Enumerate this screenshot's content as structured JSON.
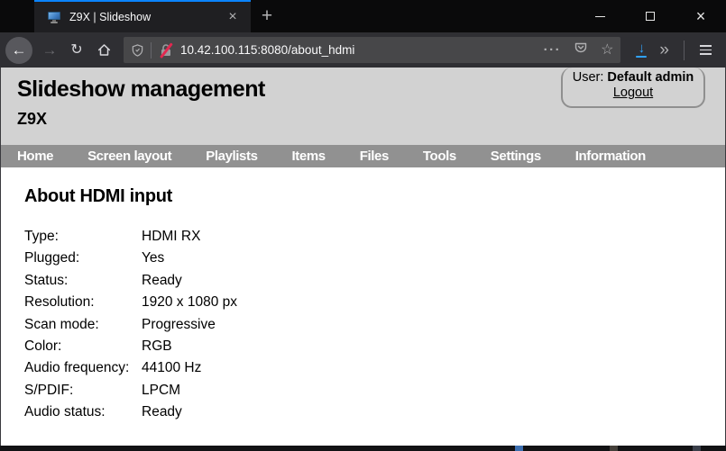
{
  "browser": {
    "tab_bar": {
      "tab_title": "Z9X | Slideshow",
      "favicon": "monitor-icon",
      "tab_close_glyph": "×",
      "new_tab_glyph": "+"
    },
    "window_controls": {
      "close_glyph": "×"
    },
    "toolbar": {
      "back_glyph": "←",
      "forward_glyph": "→",
      "reload_glyph": "↻",
      "url": "10.42.100.115:8080/about_hdmi",
      "page_actions_glyph": "···",
      "bookmark_star_glyph": "☆",
      "download_arrow_glyph": "↓",
      "overflow_glyph": "»",
      "icons": [
        "tracking-shield-icon",
        "insecure-lock-icon",
        "pocket-icon",
        "hamburger-menu-icon",
        "home-icon"
      ]
    }
  },
  "page": {
    "header": {
      "title": "Slideshow management",
      "device": "Z9X",
      "user_label": "User: ",
      "user_name": "Default admin",
      "logout_label": "Logout"
    },
    "nav": {
      "items": [
        "Home",
        "Screen layout",
        "Playlists",
        "Items",
        "Files",
        "Tools",
        "Settings",
        "Information"
      ]
    },
    "main": {
      "heading": "About HDMI input",
      "rows": [
        {
          "label": "Type:",
          "value": "HDMI RX"
        },
        {
          "label": "Plugged:",
          "value": "Yes"
        },
        {
          "label": "Status:",
          "value": "Ready"
        },
        {
          "label": "Resolution:",
          "value": "1920 x 1080 px"
        },
        {
          "label": "Scan mode:",
          "value": "Progressive"
        },
        {
          "label": "Color:",
          "value": "RGB"
        },
        {
          "label": "Audio frequency:",
          "value": "44100 Hz"
        },
        {
          "label": "S/PDIF:",
          "value": "LPCM"
        },
        {
          "label": "Audio status:",
          "value": "Ready"
        }
      ]
    }
  },
  "colors": {
    "accent_blue": "#0a84ff",
    "download_blue": "#30a3ff",
    "insecure_red": "#e22850",
    "header_gray": "#d2d2d2",
    "nav_gray": "#919191",
    "tabbar_dark": "#0a0a0b",
    "toolbar_dark": "#2f2f33",
    "urlbar_gray": "#474749"
  }
}
